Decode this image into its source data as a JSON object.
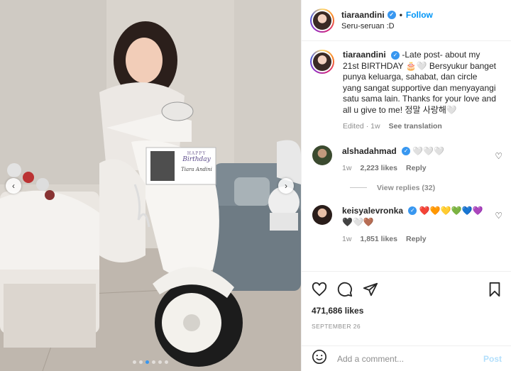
{
  "header": {
    "username": "tiaraandini",
    "separator": "•",
    "follow_label": "Follow",
    "subtitle": "Seru-seruan :D"
  },
  "caption": {
    "username": "tiaraandini",
    "text": "-Late post- about my 21st BIRTHDAY 🎂🤍 Bersyukur banget punya keluarga, sahabat, dan circle yang sangat supportive dan menyayangi satu sama lain. Thanks for your love and all u give to me! 정말 사랑해🤍",
    "edited": "Edited",
    "time": "1w",
    "see_translation": "See translation"
  },
  "comments": [
    {
      "username": "alshadahmad",
      "text": "🤍🤍🤍",
      "time": "1w",
      "likes": "2,223 likes",
      "reply": "Reply",
      "view_replies": "View replies (32)"
    },
    {
      "username": "keisyalevronka",
      "text": "❤️🧡💛💚💙💜🖤🤍🤎",
      "time": "1w",
      "likes": "1,851 likes",
      "reply": "Reply"
    }
  ],
  "photo": {
    "card_line1": "HAPPY",
    "card_line2": "Birthday",
    "card_name": "Tiara Andini"
  },
  "icons": {
    "like": "heart-icon",
    "comment": "comment-icon",
    "share": "share-icon",
    "save": "bookmark-icon",
    "emoji": "emoji-icon",
    "prev": "chevron-left-icon",
    "next": "chevron-right-icon"
  },
  "likes_count": "471,686 likes",
  "date": "SEPTEMBER 26",
  "add_comment": {
    "placeholder": "Add a comment...",
    "post_label": "Post"
  },
  "carousel": {
    "total": 6,
    "active_index": 2
  },
  "colors": {
    "accent": "#0095f6",
    "verified": "#3897f0",
    "post_disabled": "#b2dffc"
  }
}
